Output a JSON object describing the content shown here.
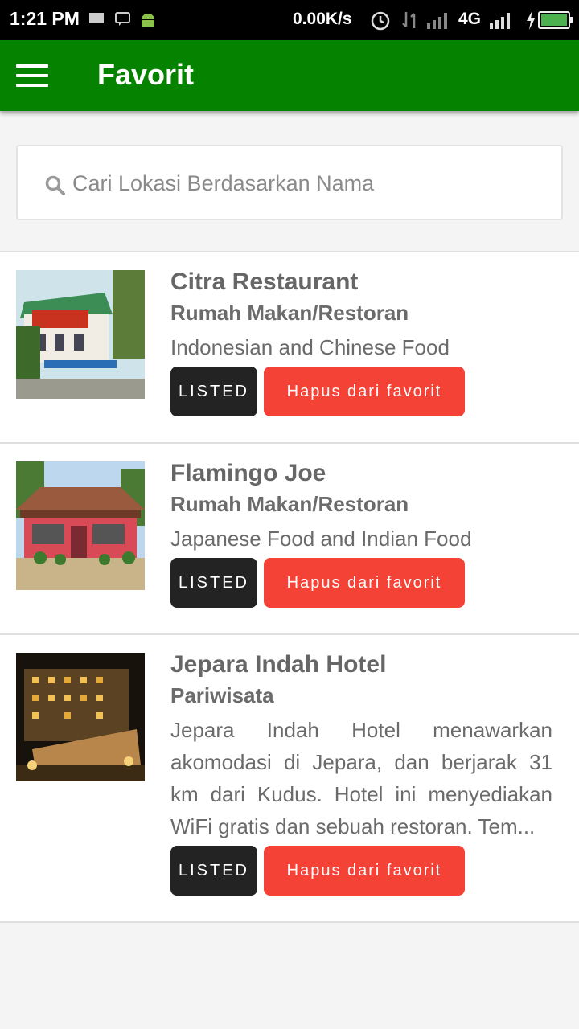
{
  "status_bar": {
    "time": "1:21 PM",
    "net_speed": "0.00K/s",
    "network_type": "4G",
    "icons": [
      "screen-icon",
      "message-icon",
      "android-icon",
      "alarm-icon",
      "data-arrows-icon",
      "signal-icon",
      "signal-icon",
      "charging-icon",
      "battery-icon"
    ]
  },
  "app_bar": {
    "title": "Favorit",
    "color": "#058200",
    "menu_icon": "hamburger-menu-icon"
  },
  "search": {
    "placeholder": "Cari Lokasi Berdasarkan Nama",
    "value": "",
    "icon": "search-icon"
  },
  "items": [
    {
      "name": "Citra Restaurant",
      "category": "Rumah Makan/Restoran",
      "description": "Indonesian and Chinese Food",
      "listed_label": "LISTED",
      "remove_label": "Hapus dari favorit"
    },
    {
      "name": "Flamingo Joe",
      "category": "Rumah Makan/Restoran",
      "description": "Japanese Food and Indian Food",
      "listed_label": "LISTED",
      "remove_label": "Hapus dari favorit"
    },
    {
      "name": "Jepara Indah Hotel",
      "category": "Pariwisata",
      "description": "Jepara Indah Hotel menawarkan akomodasi di Jepara, dan berjarak 31 km dari Kudus. Hotel ini menyediakan WiFi gratis dan sebuah restoran. Tem...",
      "listed_label": "LISTED",
      "remove_label": "Hapus dari favorit"
    }
  ],
  "colors": {
    "listed_bg": "#232323",
    "remove_bg": "#f44336"
  }
}
